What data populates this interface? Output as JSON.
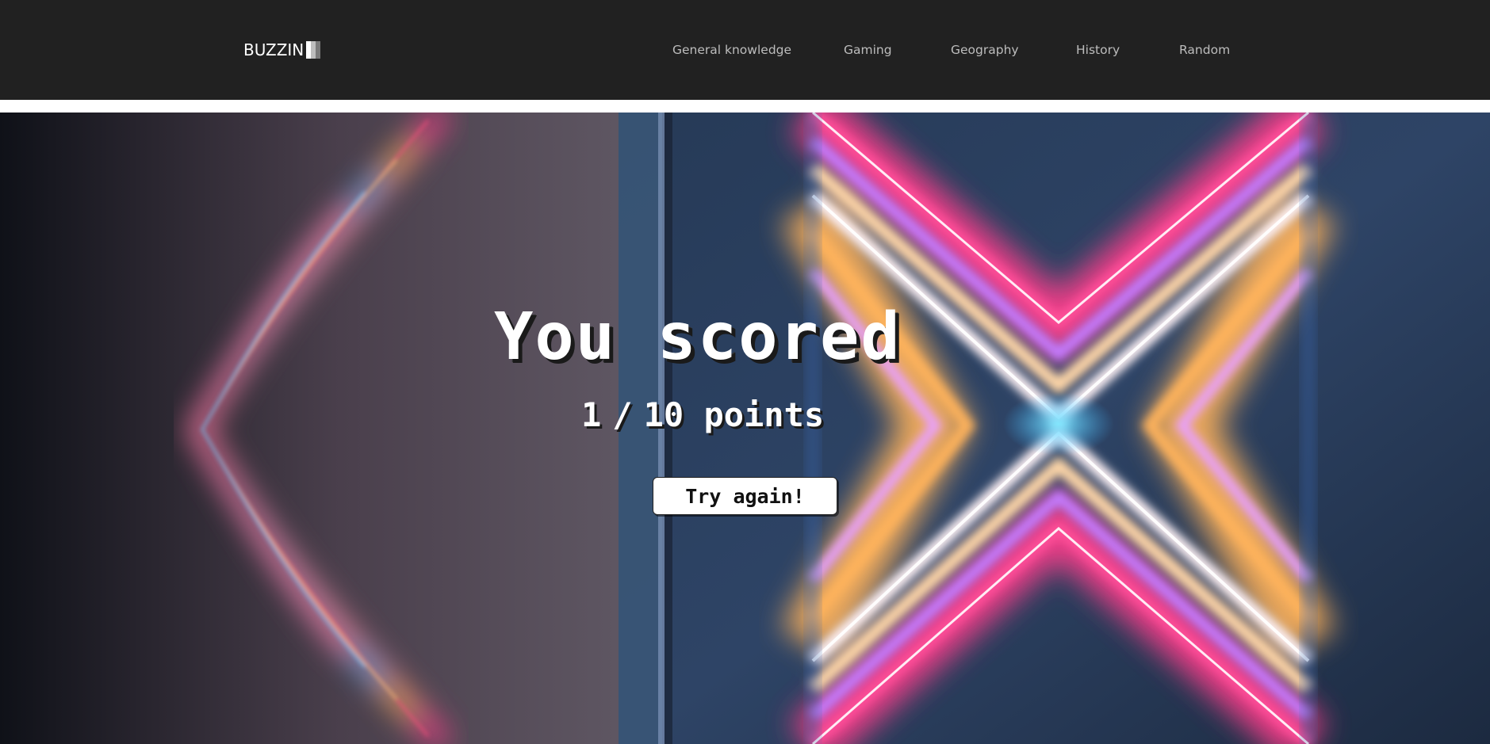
{
  "brand": {
    "name": "BUZZIN",
    "icon": "signal-bars-icon"
  },
  "nav": {
    "links": [
      {
        "label": "General knowledge"
      },
      {
        "label": "Gaming"
      },
      {
        "label": "Geography"
      },
      {
        "label": "History"
      },
      {
        "label": "Random"
      }
    ]
  },
  "result": {
    "heading": "You scored",
    "score": "1",
    "separator": "/",
    "total": "10 points",
    "retry_label": "Try again!"
  },
  "colors": {
    "navbar_bg": "#212121",
    "nav_text": "#bdbdbd",
    "brand_text": "#ffffff",
    "button_bg": "#ffffff",
    "neon_pink": "#ff3d8b",
    "neon_orange": "#ffb35c",
    "neon_blue": "#3ab4ff"
  }
}
